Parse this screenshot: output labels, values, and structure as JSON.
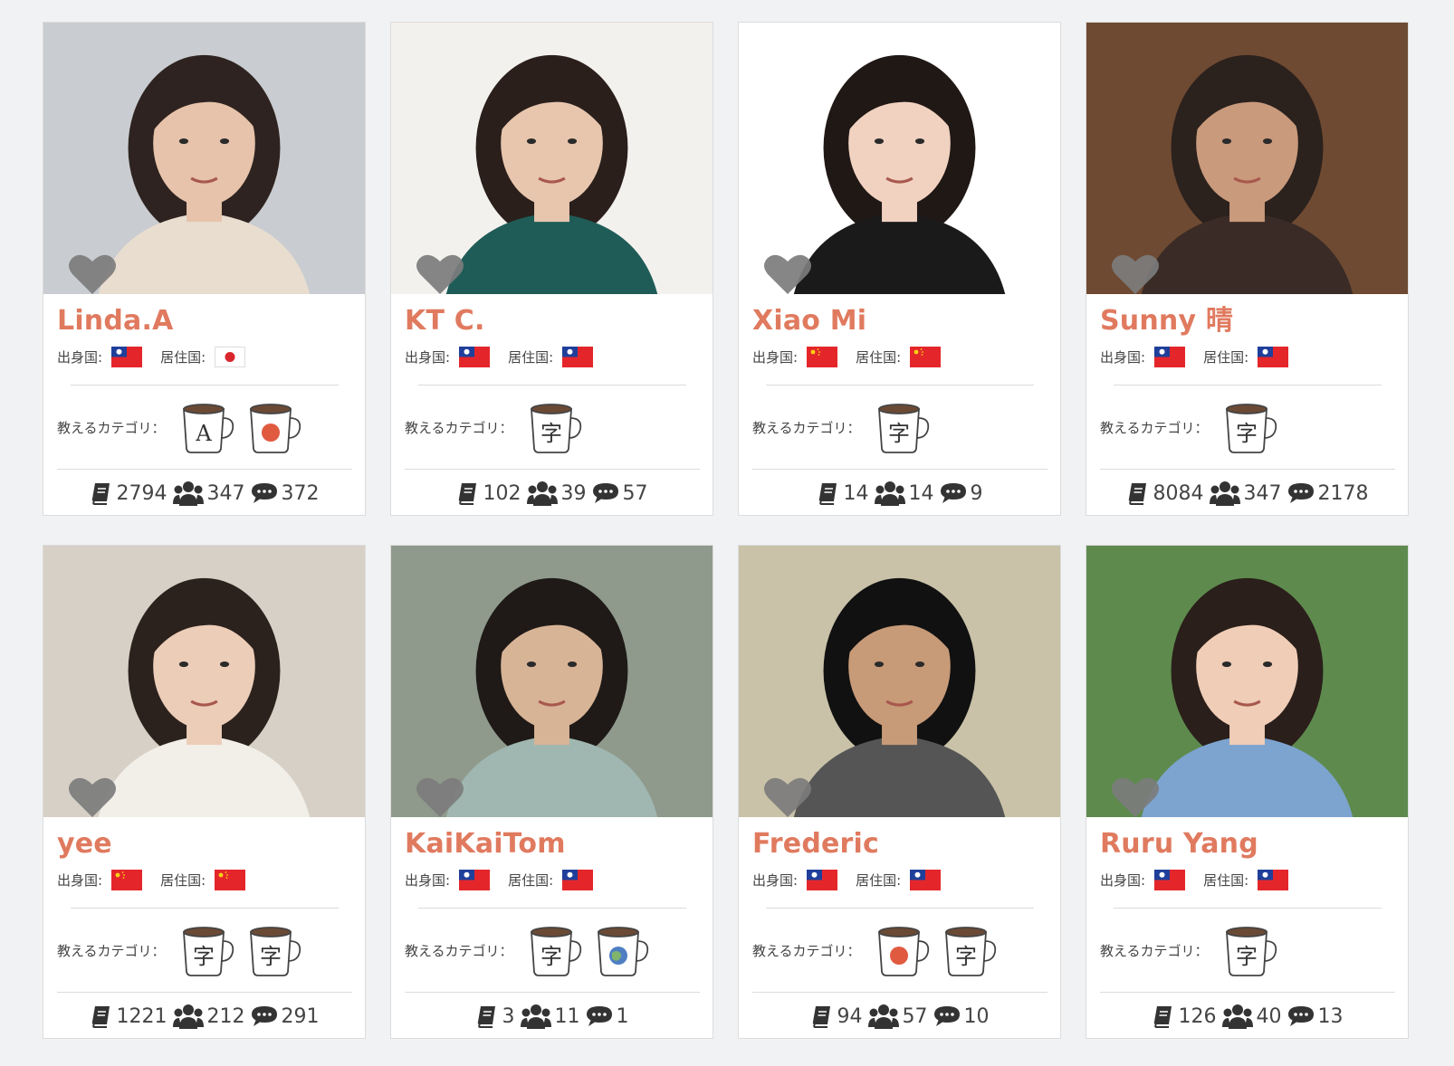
{
  "labels": {
    "origin": "出身国:",
    "residence": "居住国:",
    "categories": "教えるカテゴリ："
  },
  "colors": {
    "name": "#e07a5f",
    "heart": "#7c7c7c",
    "mug_accent": "#e05a40"
  },
  "teachers": [
    {
      "name": "Linda.A",
      "origin_flag": "taiwan-flag",
      "residence_flag": "japan-flag",
      "categories": [
        "mug-letter-a-icon",
        "mug-red-circle-icon"
      ],
      "mug_glyphs": [
        "A",
        ""
      ],
      "lessons": "2794",
      "students": "347",
      "reviews": "372",
      "photo_bg": "#c9ccd0",
      "hair": "#2e2320",
      "skin": "#e6c3aa",
      "shirt": "#e9ddd0"
    },
    {
      "name": "KT C.",
      "origin_flag": "taiwan-flag",
      "residence_flag": "taiwan-flag",
      "categories": [
        "mug-zi-icon"
      ],
      "mug_glyphs": [
        "字"
      ],
      "lessons": "102",
      "students": "39",
      "reviews": "57",
      "photo_bg": "#f3f1ee",
      "hair": "#2a1f1b",
      "skin": "#e8c6ae",
      "shirt": "#1f5c57"
    },
    {
      "name": "Xiao Mi",
      "origin_flag": "china-flag",
      "residence_flag": "china-flag",
      "categories": [
        "mug-zi-icon"
      ],
      "mug_glyphs": [
        "字"
      ],
      "lessons": "14",
      "students": "14",
      "reviews": "9",
      "photo_bg": "#ffffff",
      "hair": "#201815",
      "skin": "#f1d2c1",
      "shirt": "#1a1a1a"
    },
    {
      "name": "Sunny 晴",
      "origin_flag": "taiwan-flag",
      "residence_flag": "taiwan-flag",
      "categories": [
        "mug-zi-icon"
      ],
      "mug_glyphs": [
        "字"
      ],
      "lessons": "8084",
      "students": "347",
      "reviews": "2178",
      "photo_bg": "#6e4a32",
      "hair": "#2b211d",
      "skin": "#c99a7c",
      "shirt": "#3a2b26"
    },
    {
      "name": "yee",
      "origin_flag": "china-flag",
      "residence_flag": "china-flag",
      "categories": [
        "mug-zi-icon",
        "mug-zi-icon"
      ],
      "mug_glyphs": [
        "字",
        "字"
      ],
      "lessons": "1221",
      "students": "212",
      "reviews": "291",
      "photo_bg": "#d7d0c6",
      "hair": "#2c221d",
      "skin": "#eccdb8",
      "shirt": "#f2efe9"
    },
    {
      "name": "KaiKaiTom",
      "origin_flag": "taiwan-flag",
      "residence_flag": "taiwan-flag",
      "categories": [
        "mug-zi-icon",
        "mug-globe-icon"
      ],
      "mug_glyphs": [
        "字",
        ""
      ],
      "lessons": "3",
      "students": "11",
      "reviews": "1",
      "photo_bg": "#8f9a8c",
      "hair": "#1f1a17",
      "skin": "#d8b497",
      "shirt": "#9fb7b0"
    },
    {
      "name": "Frederic",
      "origin_flag": "taiwan-flag",
      "residence_flag": "taiwan-flag",
      "categories": [
        "mug-red-circle-icon",
        "mug-zi-icon"
      ],
      "mug_glyphs": [
        "",
        "字"
      ],
      "lessons": "94",
      "students": "57",
      "reviews": "10",
      "photo_bg": "#c9c2a8",
      "hair": "#111111",
      "skin": "#c79a78",
      "shirt": "#555555"
    },
    {
      "name": "Ruru Yang",
      "origin_flag": "taiwan-flag",
      "residence_flag": "taiwan-flag",
      "categories": [
        "mug-zi-icon"
      ],
      "mug_glyphs": [
        "字"
      ],
      "lessons": "126",
      "students": "40",
      "reviews": "13",
      "photo_bg": "#5e8a4e",
      "hair": "#2a1f1a",
      "skin": "#f0cdb7",
      "shirt": "#7da3cf"
    }
  ]
}
